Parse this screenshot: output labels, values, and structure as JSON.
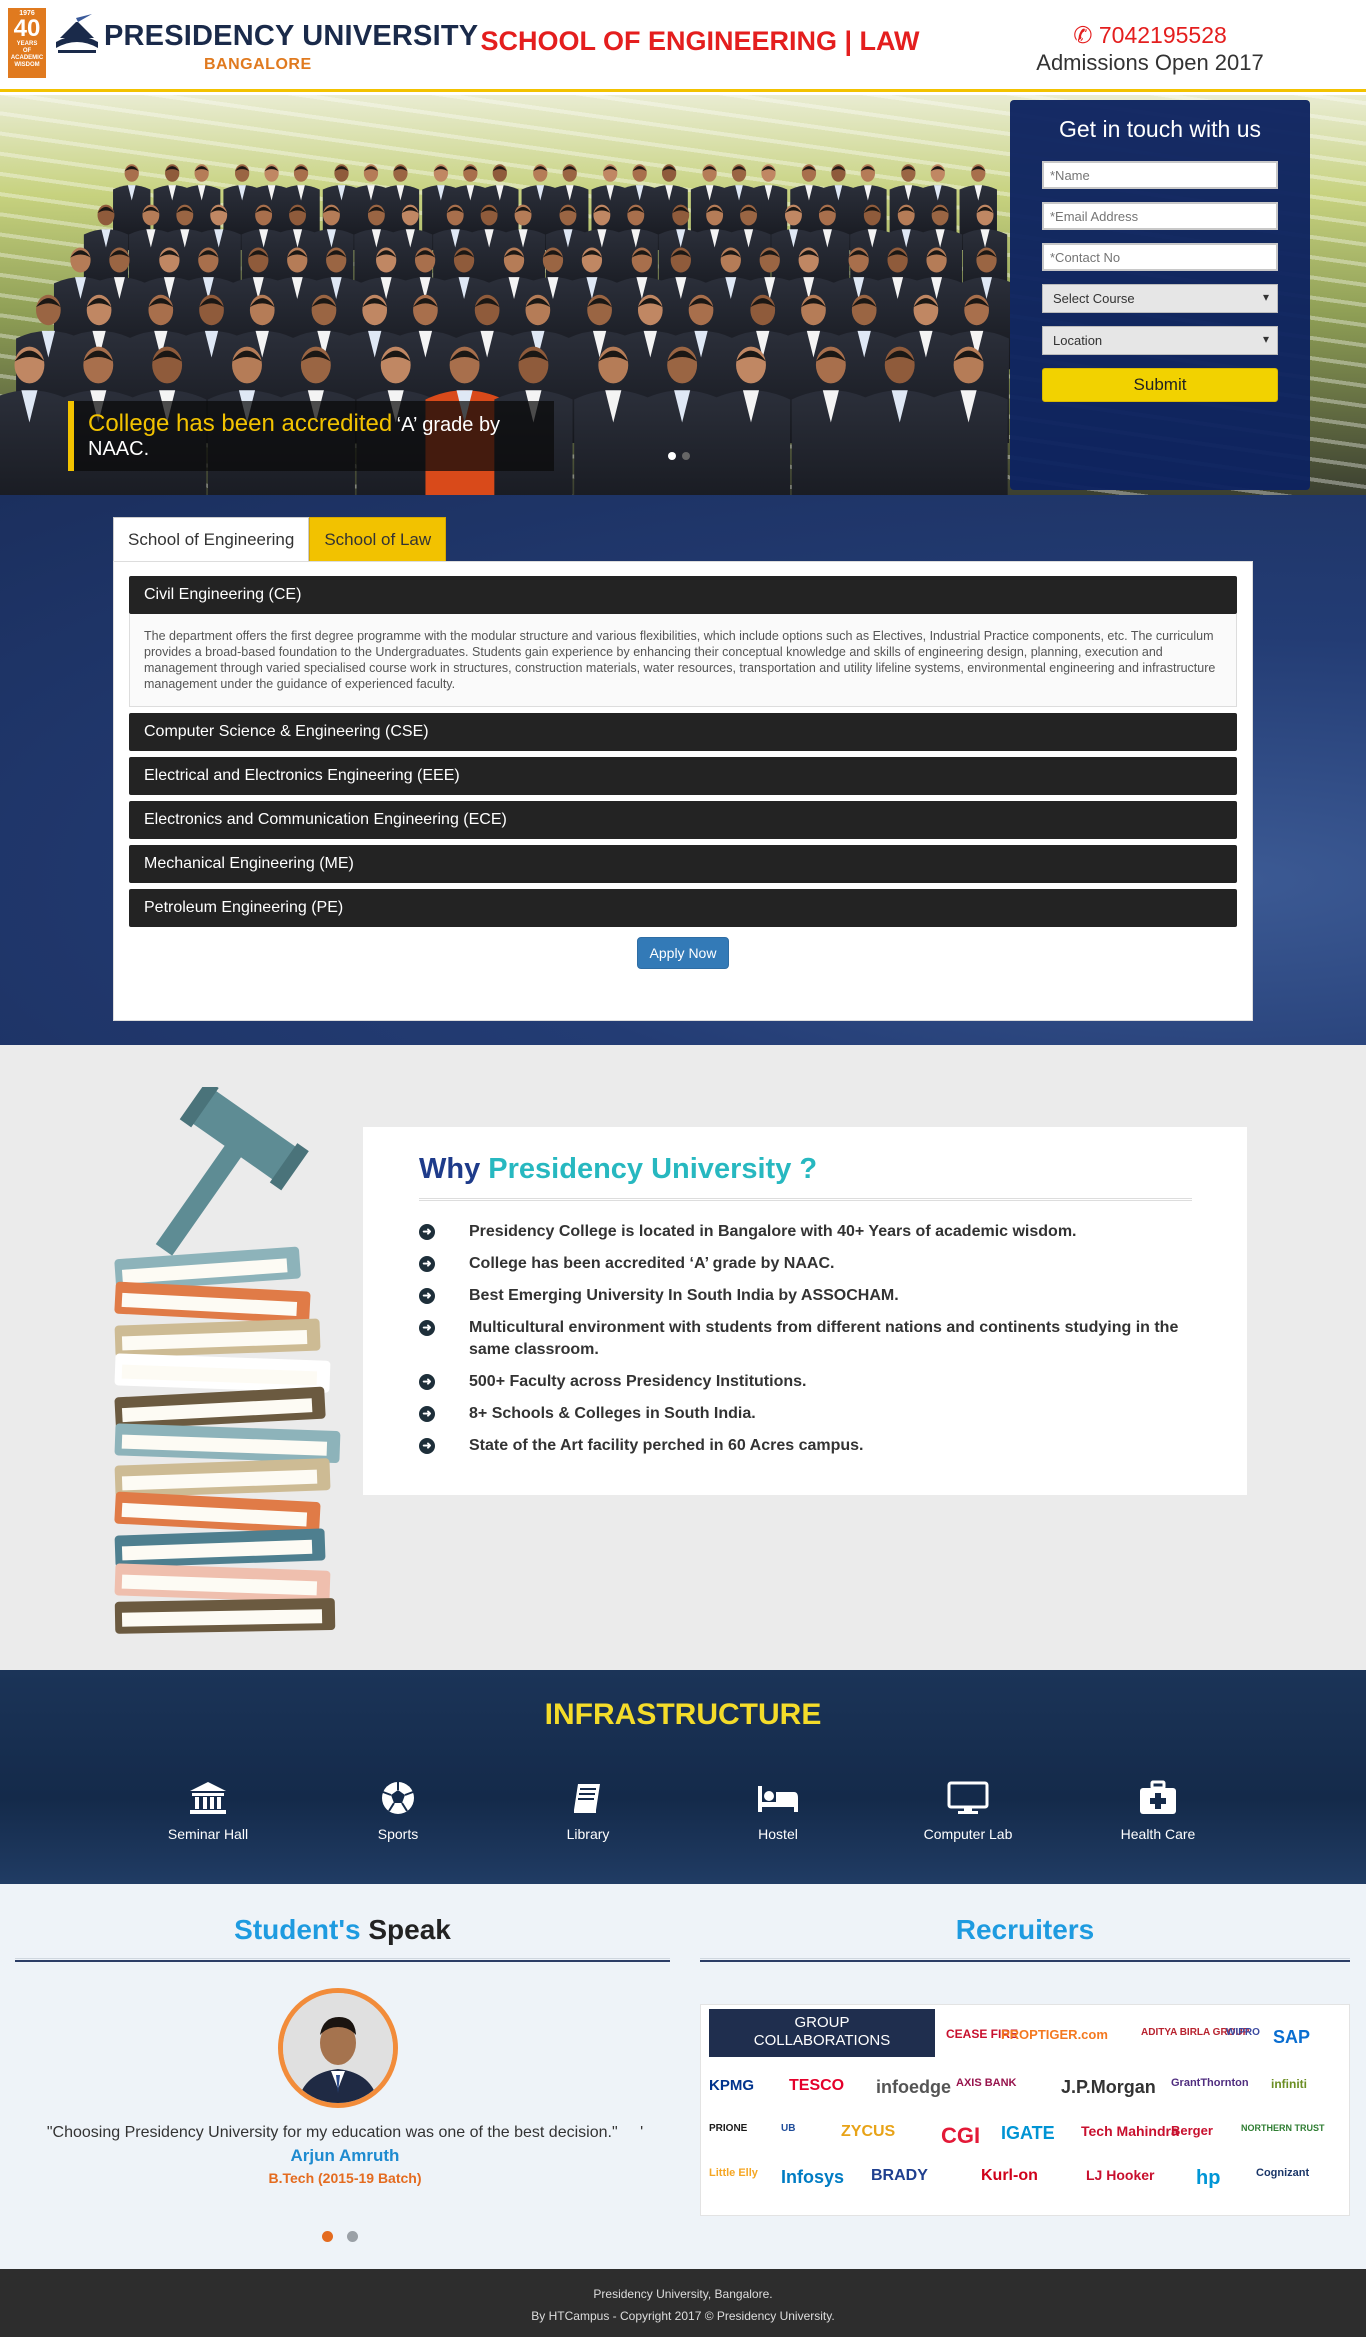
{
  "header": {
    "badge_top": "1976",
    "badge_number": "40",
    "badge_line1": "YEARS",
    "badge_line2": "OF ACADEMIC",
    "badge_line3": "WISDOM",
    "university_name": "PRESIDENCY UNIVERSITY",
    "city": "BANGALORE",
    "school_title": "SCHOOL OF ENGINEERING | LAW",
    "phone": "7042195528",
    "admissions": "Admissions Open 2017"
  },
  "hero": {
    "caption_highlight": "College has been accredited",
    "caption_rest": "‘A’ grade by NAAC.",
    "slides": 2,
    "active_slide": 0
  },
  "enquiry_form": {
    "title": "Get in touch with us",
    "name_placeholder": "*Name",
    "email_placeholder": "*Email Address",
    "contact_placeholder": "*Contact No",
    "course_select": "Select Course",
    "location_select": "Location",
    "submit_label": "Submit"
  },
  "courses": {
    "tabs": [
      "School of Engineering",
      "School of Law"
    ],
    "active_tab": 0,
    "items": [
      "Civil Engineering (CE)",
      "Computer Science & Engineering (CSE)",
      "Electrical and Electronics Engineering (EEE)",
      "Electronics and Communication Engineering (ECE)",
      "Mechanical Engineering (ME)",
      "Petroleum Engineering (PE)"
    ],
    "expanded_description": "The department offers the first degree programme with the modular structure and various flexibilities, which include options such as Electives, Industrial Practice components, etc. The curriculum provides a broad-based foundation to the Undergraduates. Students gain experience by enhancing their conceptual knowledge and skills of engineering design, planning, execution and management through varied specialised course work in structures, construction materials, water resources, transportation and utility lifeline systems, environmental engineering and infrastructure management under the guidance of experienced faculty.",
    "apply_label": "Apply Now"
  },
  "why": {
    "title_prefix": "Why",
    "title_highlight": "Presidency University ?",
    "points": [
      "Presidency College is located in Bangalore with 40+ Years of academic wisdom.",
      "College has been accredited ‘A’ grade by NAAC.",
      "Best Emerging University In South India by ASSOCHAM.",
      "Multicultural environment with students from different nations and continents studying in the same classroom.",
      "500+ Faculty across Presidency Institutions.",
      "8+ Schools & Colleges in South India.",
      "State of the Art facility perched in 60 Acres campus."
    ]
  },
  "infrastructure": {
    "title": "INFRASTRUCTURE",
    "items": [
      {
        "label": "Seminar Hall",
        "icon": "bank-icon"
      },
      {
        "label": "Sports",
        "icon": "football-icon"
      },
      {
        "label": "Library",
        "icon": "book-icon"
      },
      {
        "label": "Hostel",
        "icon": "bed-icon"
      },
      {
        "label": "Computer Lab",
        "icon": "desktop-icon"
      },
      {
        "label": "Health Care",
        "icon": "medkit-icon"
      }
    ]
  },
  "students_speak": {
    "title_highlight": "Student's",
    "title_rest": "Speak",
    "quote": "\"Choosing Presidency University for my education was one of the best decision.\"",
    "quote_mark": "'",
    "name": "Arjun Amruth",
    "batch": "B.Tech (2015-19 Batch)",
    "slides": 2,
    "active_slide": 0
  },
  "recruiters": {
    "title": "Recruiters",
    "group_label_line1": "GROUP",
    "group_label_line2": "COLLABORATIONS",
    "logos": [
      {
        "name": "CEASE FIRE",
        "color": "#c8102e"
      },
      {
        "name": "PROPTIGER.com",
        "color": "#f47920"
      },
      {
        "name": "ADITYA BIRLA GROUP",
        "color": "#b8232f"
      },
      {
        "name": "WIPRO",
        "color": "#3b4aa0"
      },
      {
        "name": "SAP",
        "color": "#0a6ed1"
      },
      {
        "name": "KPMG",
        "color": "#00338d"
      },
      {
        "name": "TESCO",
        "color": "#e4002b"
      },
      {
        "name": "infoedge",
        "color": "#555555"
      },
      {
        "name": "AXIS BANK",
        "color": "#97144d"
      },
      {
        "name": "J.P.Morgan",
        "color": "#333333"
      },
      {
        "name": "GrantThornton",
        "color": "#4f2d7f"
      },
      {
        "name": "infiniti",
        "color": "#6b8e23"
      },
      {
        "name": "PRIONE",
        "color": "#1a1a1a"
      },
      {
        "name": "UB",
        "color": "#1e4c9a"
      },
      {
        "name": "ZYCUS",
        "color": "#e8a317"
      },
      {
        "name": "CGI",
        "color": "#e31937"
      },
      {
        "name": "IGATE",
        "color": "#0094d4"
      },
      {
        "name": "Tech Mahindra",
        "color": "#c8102e"
      },
      {
        "name": "Berger",
        "color": "#c8102e"
      },
      {
        "name": "NORTHERN TRUST",
        "color": "#2e7d32"
      },
      {
        "name": "Little Elly",
        "color": "#f5a623"
      },
      {
        "name": "Infosys",
        "color": "#007cc3"
      },
      {
        "name": "BRADY",
        "color": "#1f3f8f"
      },
      {
        "name": "Kurl-on",
        "color": "#d0021b"
      },
      {
        "name": "LJ Hooker",
        "color": "#c8102e"
      },
      {
        "name": "hp",
        "color": "#0096d6"
      },
      {
        "name": "Cognizant",
        "color": "#1a3668"
      }
    ]
  },
  "footer": {
    "line1": "Presidency University, Bangalore.",
    "line2": "By HTCampus - Copyright 2017 © Presidency University."
  },
  "colors": {
    "accent_yellow": "#f2c200",
    "header_red": "#e41e1e",
    "navy": "#0c2260",
    "teal": "#27b8c0",
    "orange": "#e46b1f"
  }
}
